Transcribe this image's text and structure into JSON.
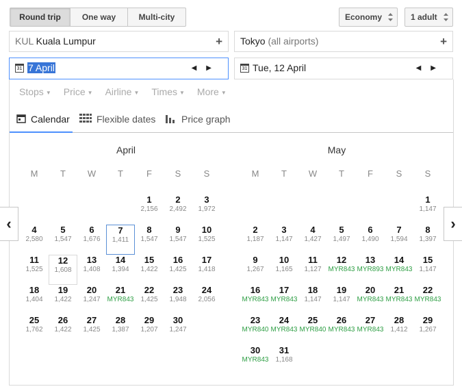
{
  "trip_types": [
    "Round trip",
    "One way",
    "Multi-city"
  ],
  "cabin": "Economy",
  "passengers": "1 adult",
  "origin": {
    "code": "KUL",
    "city": "Kuala Lumpur"
  },
  "destination": {
    "city": "Tokyo",
    "note": "(all airports)"
  },
  "depart_date": "7 April",
  "return_date": "Tue, 12 April",
  "filters": [
    "Stops",
    "Price",
    "Airline",
    "Times",
    "More"
  ],
  "tabs": [
    "Calendar",
    "Flexible dates",
    "Price graph"
  ],
  "weekdays": [
    "M",
    "T",
    "W",
    "T",
    "F",
    "S",
    "S"
  ],
  "months": [
    {
      "name": "April",
      "days": [
        {
          "day": "1",
          "price": "2,156"
        },
        {
          "day": "2",
          "price": "2,492"
        },
        {
          "day": "3",
          "price": "1,972"
        },
        {
          "day": "4",
          "price": "2,580"
        },
        {
          "day": "5",
          "price": "1,547"
        },
        {
          "day": "6",
          "price": "1,676"
        },
        {
          "day": "7",
          "price": "1,411"
        },
        {
          "day": "8",
          "price": "1,547"
        },
        {
          "day": "9",
          "price": "1,547"
        },
        {
          "day": "10",
          "price": "1,525"
        },
        {
          "day": "11",
          "price": "1,525"
        },
        {
          "day": "12",
          "price": "1,608"
        },
        {
          "day": "13",
          "price": "1,408"
        },
        {
          "day": "14",
          "price": "1,394"
        },
        {
          "day": "15",
          "price": "1,422"
        },
        {
          "day": "16",
          "price": "1,425"
        },
        {
          "day": "17",
          "price": "1,418"
        },
        {
          "day": "18",
          "price": "1,404"
        },
        {
          "day": "19",
          "price": "1,422"
        },
        {
          "day": "20",
          "price": "1,247"
        },
        {
          "day": "21",
          "price": "MYR843",
          "cheap": true
        },
        {
          "day": "22",
          "price": "1,425"
        },
        {
          "day": "23",
          "price": "1,948"
        },
        {
          "day": "24",
          "price": "2,056"
        },
        {
          "day": "25",
          "price": "1,762"
        },
        {
          "day": "26",
          "price": "1,422"
        },
        {
          "day": "27",
          "price": "1,425"
        },
        {
          "day": "28",
          "price": "1,387"
        },
        {
          "day": "29",
          "price": "1,207"
        },
        {
          "day": "30",
          "price": "1,247"
        }
      ]
    },
    {
      "name": "May",
      "days": [
        {
          "day": "1",
          "price": "1,147"
        },
        {
          "day": "2",
          "price": "1,187"
        },
        {
          "day": "3",
          "price": "1,147"
        },
        {
          "day": "4",
          "price": "1,427"
        },
        {
          "day": "5",
          "price": "1,497"
        },
        {
          "day": "6",
          "price": "1,490"
        },
        {
          "day": "7",
          "price": "1,594"
        },
        {
          "day": "8",
          "price": "1,397"
        },
        {
          "day": "9",
          "price": "1,267"
        },
        {
          "day": "10",
          "price": "1,165"
        },
        {
          "day": "11",
          "price": "1,127"
        },
        {
          "day": "12",
          "price": "MYR843",
          "cheap": true
        },
        {
          "day": "13",
          "price": "MYR893",
          "cheap": true
        },
        {
          "day": "14",
          "price": "MYR843",
          "cheap": true
        },
        {
          "day": "15",
          "price": "1,147"
        },
        {
          "day": "16",
          "price": "MYR843",
          "cheap": true
        },
        {
          "day": "17",
          "price": "MYR843",
          "cheap": true
        },
        {
          "day": "18",
          "price": "1,147"
        },
        {
          "day": "19",
          "price": "1,147"
        },
        {
          "day": "20",
          "price": "MYR843",
          "cheap": true
        },
        {
          "day": "21",
          "price": "MYR843",
          "cheap": true
        },
        {
          "day": "22",
          "price": "MYR843",
          "cheap": true
        },
        {
          "day": "23",
          "price": "MYR840",
          "cheap": true
        },
        {
          "day": "24",
          "price": "MYR843",
          "cheap": true
        },
        {
          "day": "25",
          "price": "MYR840",
          "cheap": true
        },
        {
          "day": "26",
          "price": "MYR843",
          "cheap": true
        },
        {
          "day": "27",
          "price": "MYR843",
          "cheap": true
        },
        {
          "day": "28",
          "price": "1,412"
        },
        {
          "day": "29",
          "price": "1,267"
        },
        {
          "day": "30",
          "price": "MYR843",
          "cheap": true
        },
        {
          "day": "31",
          "price": "1,168"
        }
      ]
    }
  ],
  "selected_day": "7",
  "hovered_day": "12"
}
